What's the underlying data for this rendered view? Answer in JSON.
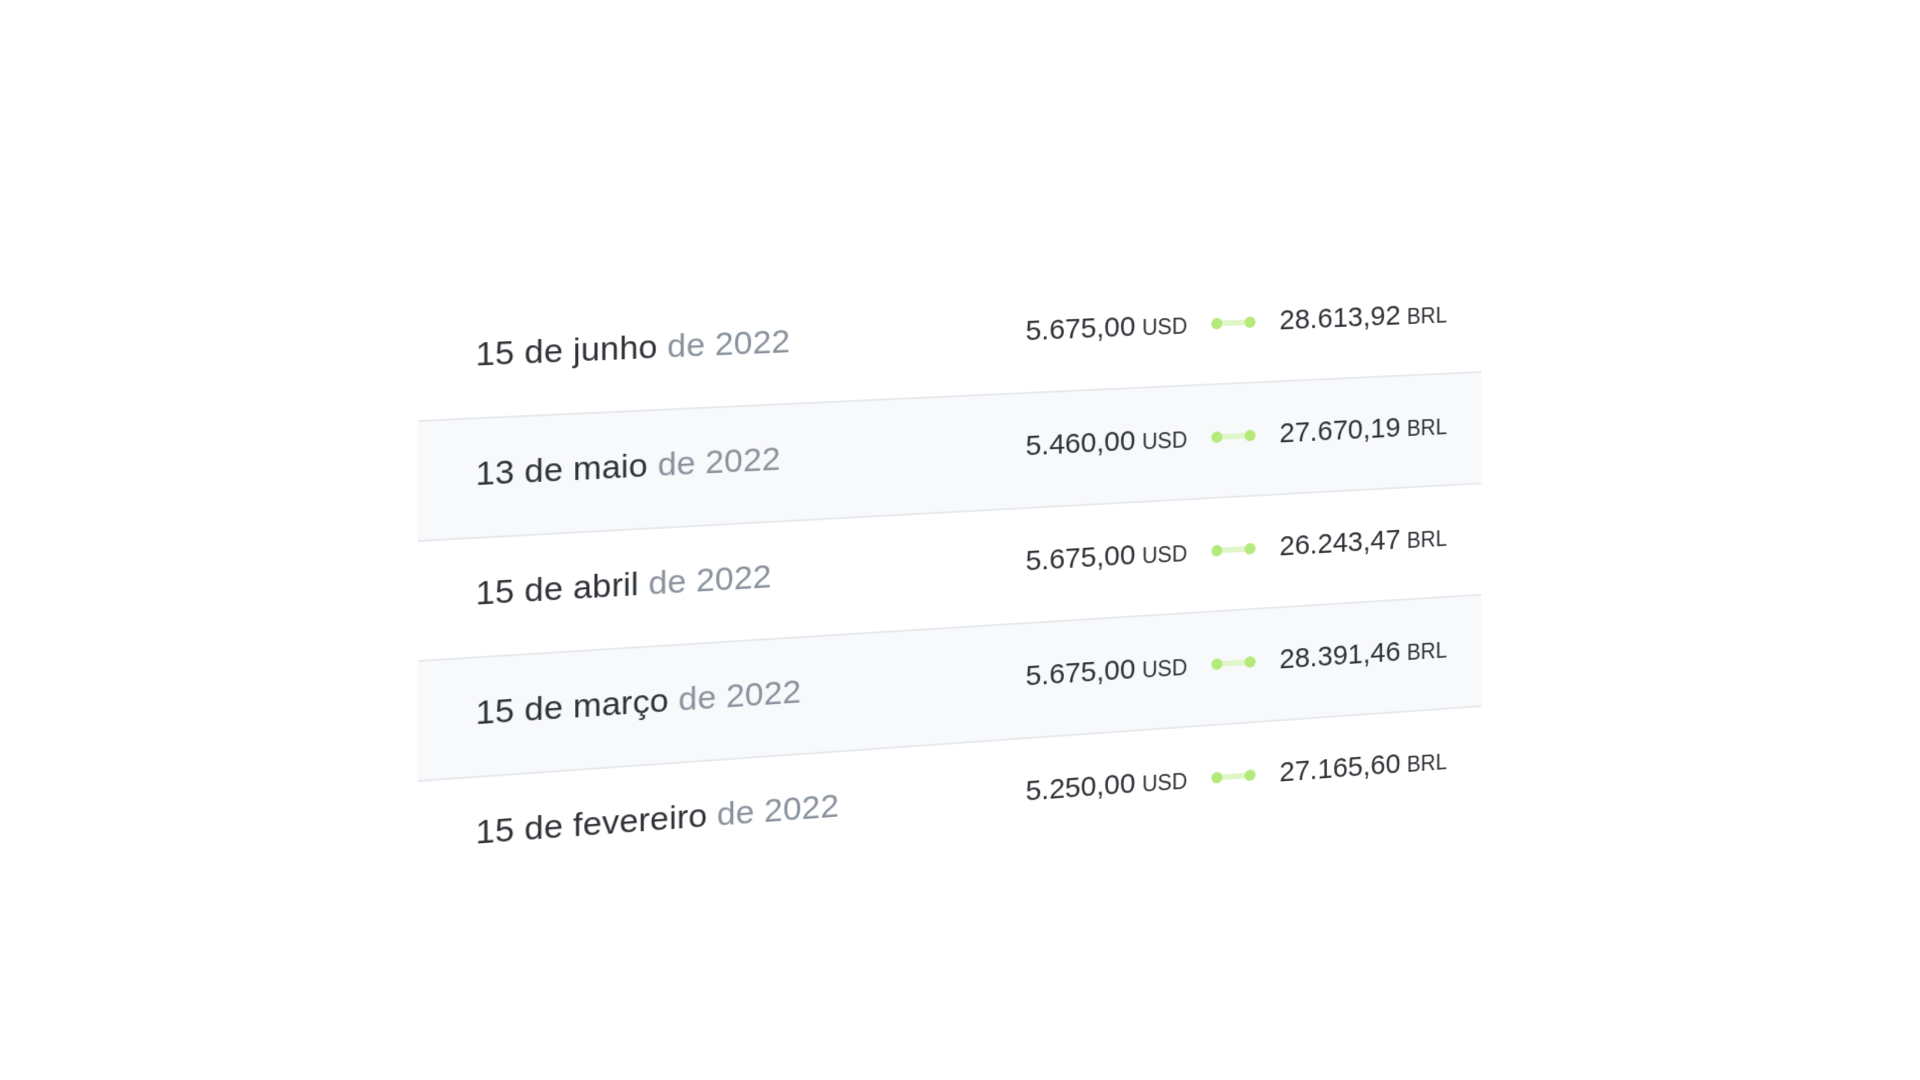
{
  "payments": [
    {
      "day_month": "15 de junho",
      "year": "de 2022",
      "usd_amount": "5.675,00",
      "usd_code": "USD",
      "brl_amount": "28.613,92",
      "brl_code": "BRL"
    },
    {
      "day_month": "13 de maio",
      "year": "de 2022",
      "usd_amount": "5.460,00",
      "usd_code": "USD",
      "brl_amount": "27.670,19",
      "brl_code": "BRL"
    },
    {
      "day_month": "15 de abril",
      "year": "de 2022",
      "usd_amount": "5.675,00",
      "usd_code": "USD",
      "brl_amount": "26.243,47",
      "brl_code": "BRL"
    },
    {
      "day_month": "15 de março",
      "year": "de 2022",
      "usd_amount": "5.675,00",
      "usd_code": "USD",
      "brl_amount": "28.391,46",
      "brl_code": "BRL"
    },
    {
      "day_month": "15 de fevereiro",
      "year": "de 2022",
      "usd_amount": "5.250,00",
      "usd_code": "USD",
      "brl_amount": "27.165,60",
      "brl_code": "BRL"
    }
  ],
  "colors": {
    "text": "#2e3136",
    "muted_year": "#8a929d",
    "row_alt_bg": "#f8f9fb",
    "divider": "#e6e9ee",
    "connector_dot": "#b4ea7c",
    "connector_bar": "#e1f6c8"
  },
  "icons": {
    "conversion": "conversion-connector-icon"
  }
}
